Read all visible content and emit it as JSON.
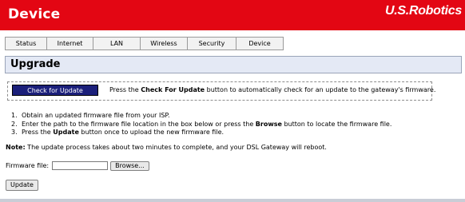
{
  "header": {
    "title": "Device",
    "logo_text": "U.S.Robotics",
    "bg_color": "#e30613"
  },
  "nav": {
    "items": [
      {
        "label": "Status"
      },
      {
        "label": "Internet"
      },
      {
        "label": "LAN"
      },
      {
        "label": "Wireless"
      },
      {
        "label": "Security"
      },
      {
        "label": "Device"
      }
    ]
  },
  "panel": {
    "title": "Upgrade"
  },
  "check": {
    "button_label": "Check for Update",
    "text_before": "Press the ",
    "text_bold": "Check For Update",
    "text_after": " button to automatically check for an update to the gateway's firmware."
  },
  "steps": [
    {
      "num": "1.",
      "before": "Obtain an updated firmware file from your ISP.",
      "bold": "",
      "after": ""
    },
    {
      "num": "2.",
      "before": "Enter the path to the firmware file location in the box below or press the ",
      "bold": "Browse",
      "after": " button to locate the firmware file."
    },
    {
      "num": "3.",
      "before": "Press the ",
      "bold": "Update",
      "after": " button once to upload the new firmware file."
    }
  ],
  "note": {
    "label": "Note:",
    "text": " The update process takes about two minutes to complete, and your DSL Gateway will reboot."
  },
  "firmware": {
    "label": "Firmware file:",
    "value": "",
    "browse_label": "Browse..."
  },
  "update": {
    "label": "Update"
  }
}
